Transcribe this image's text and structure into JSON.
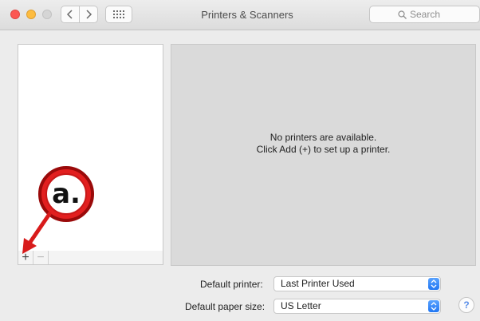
{
  "window": {
    "title": "Printers & Scanners",
    "traffic_lights": {
      "close": "#fc5753",
      "minimize": "#fdbc40",
      "zoom": "#d5d5d5"
    },
    "nav": {
      "back_icon": "chevron-left-icon",
      "forward_icon": "chevron-right-icon",
      "show_all_icon": "grid-icon"
    },
    "search": {
      "placeholder": "Search",
      "icon": "magnifier-icon"
    }
  },
  "printer_list": {
    "items": [],
    "add_label": "+",
    "remove_label": "−"
  },
  "detail": {
    "line1": "No printers are available.",
    "line2": "Click Add (+) to set up a printer."
  },
  "settings": {
    "default_printer_label": "Default printer:",
    "default_printer_value": "Last Printer Used",
    "paper_size_label": "Default paper size:",
    "paper_size_value": "US Letter"
  },
  "help": {
    "label": "?"
  },
  "annotation": {
    "label": "a.",
    "color": "#e21f1f"
  }
}
